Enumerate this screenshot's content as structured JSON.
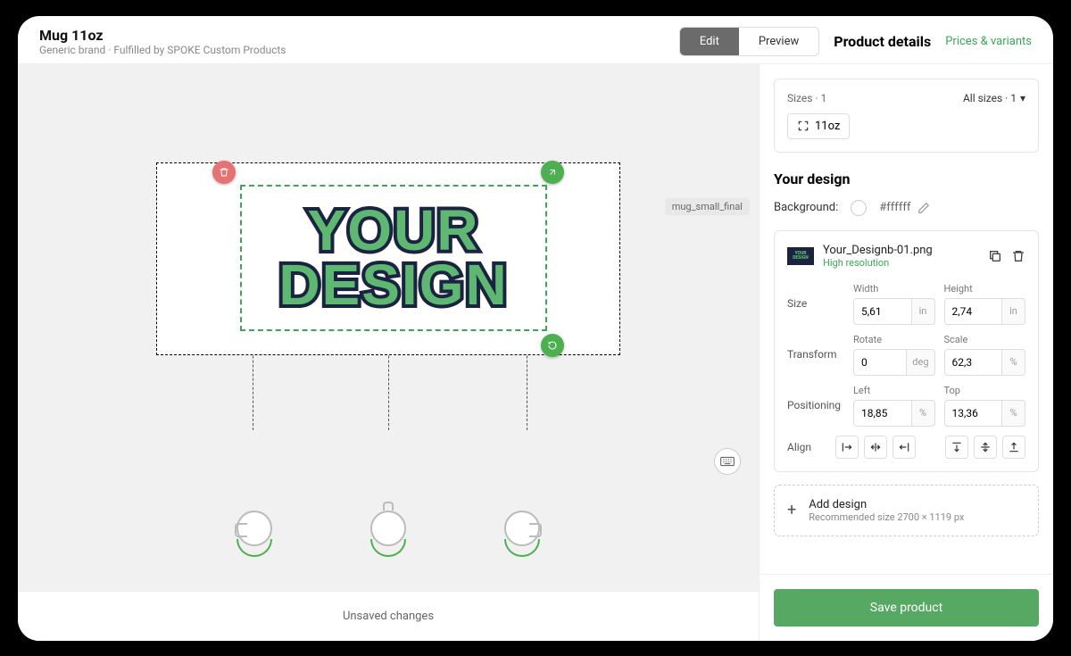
{
  "header": {
    "title": "Mug 11oz",
    "subtitle": "Generic brand · Fulfilled by SPOKE Custom Products",
    "edit": "Edit",
    "preview": "Preview",
    "product_details": "Product details",
    "prices_link": "Prices & variants"
  },
  "canvas": {
    "design_line1": "YOUR",
    "design_line2": "DESIGN",
    "chip": "mug_small_final",
    "unsaved": "Unsaved changes"
  },
  "sidebar": {
    "sizes_label": "Sizes · 1",
    "all_sizes": "All sizes · 1",
    "size_value": "11oz",
    "your_design": "Your design",
    "bg_label": "Background:",
    "bg_hex": "#ffffff",
    "file": {
      "name": "Your_Designb-01.png",
      "res": "High resolution"
    },
    "size": {
      "label": "Size",
      "width_label": "Width",
      "width": "5,61",
      "width_unit": "in",
      "height_label": "Height",
      "height": "2,74",
      "height_unit": "in"
    },
    "transform": {
      "label": "Transform",
      "rotate_label": "Rotate",
      "rotate": "0",
      "rotate_unit": "deg",
      "scale_label": "Scale",
      "scale": "62,3",
      "scale_unit": "%"
    },
    "position": {
      "label": "Positioning",
      "left_label": "Left",
      "left": "18,85",
      "left_unit": "%",
      "top_label": "Top",
      "top": "13,36",
      "top_unit": "%"
    },
    "align_label": "Align",
    "add_title": "Add design",
    "add_sub": "Recommended size 2700 × 1119 px",
    "save": "Save product"
  }
}
